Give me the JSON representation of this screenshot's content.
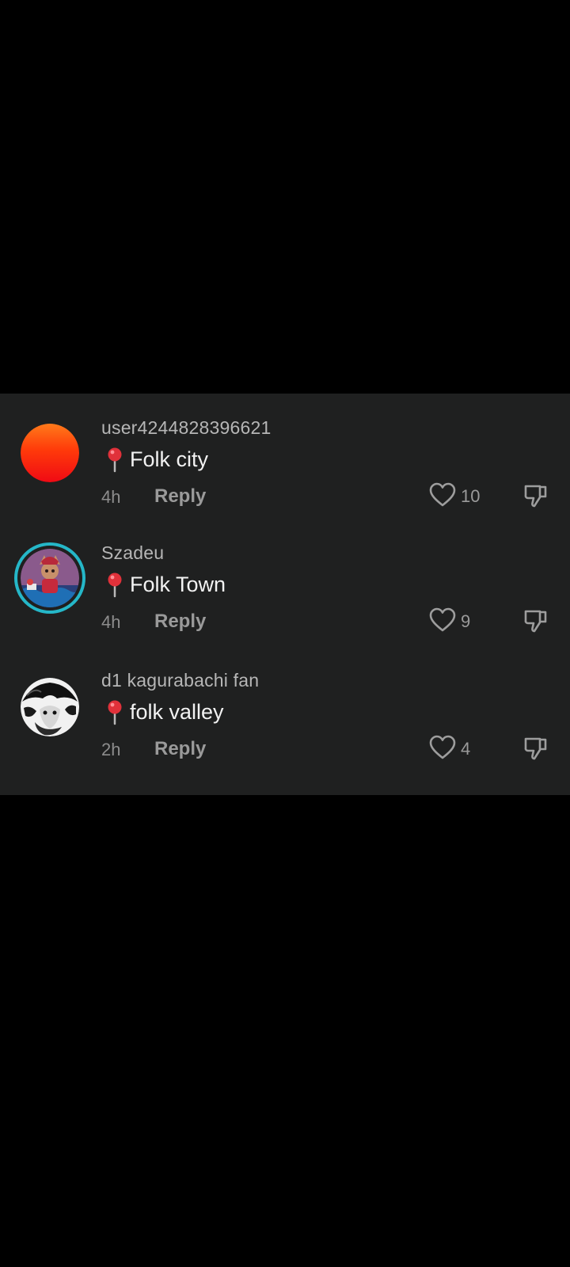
{
  "comments": [
    {
      "username": "user4244828396621",
      "text": "Folk city",
      "time": "4h",
      "reply_label": "Reply",
      "likes": "10",
      "avatar": "red-orange-gradient-avatar"
    },
    {
      "username": "Szadeu",
      "text": "Folk Town",
      "time": "4h",
      "reply_label": "Reply",
      "likes": "9",
      "avatar": "cartoon-character-avatar-with-story-ring"
    },
    {
      "username": "d1 kagurabachi fan",
      "text": "folk valley",
      "time": "2h",
      "reply_label": "Reply",
      "likes": "4",
      "avatar": "black-white-manga-avatar"
    }
  ],
  "icons": {
    "pin": "round-pushpin-icon",
    "like": "heart-outline-icon",
    "dislike": "thumbs-down-outline-icon"
  },
  "colors": {
    "background": "#000000",
    "panel": "#1f2020",
    "story_ring": "#25b7c8",
    "pin": "#e0313a"
  }
}
